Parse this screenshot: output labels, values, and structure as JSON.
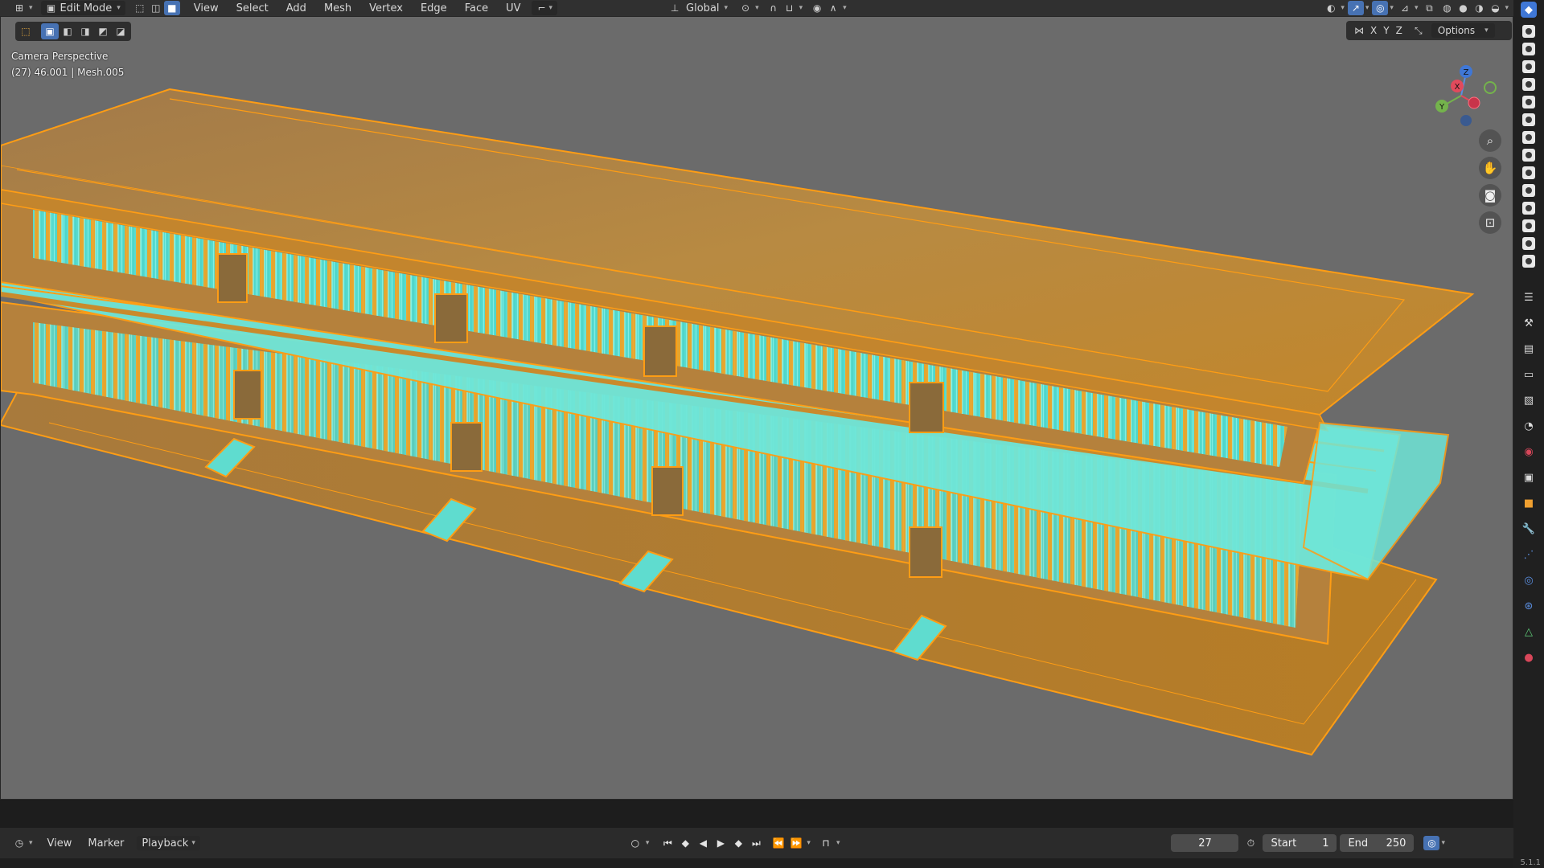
{
  "header": {
    "mode": "Edit Mode",
    "menus": [
      "View",
      "Select",
      "Add",
      "Mesh",
      "Vertex",
      "Edge",
      "Face",
      "UV"
    ],
    "transform_orientation": "Global"
  },
  "viewport": {
    "view_name": "Camera Perspective",
    "object_info": "(27) 46.001 | Mesh.005",
    "axis_x": "X",
    "axis_y": "Y",
    "axis_z": "Z",
    "options_label": "Options",
    "gizmo": {
      "z": "Z",
      "x": "X",
      "y": "Y"
    },
    "colors": {
      "background": "#6b6b6b",
      "face_selected": "#c98a2c",
      "edge_selected": "#ff9d14",
      "glass": "#7ff0e0"
    }
  },
  "timeline": {
    "menus": [
      "View",
      "Marker",
      "Playback"
    ],
    "current_frame": "27",
    "start_label": "Start",
    "start_value": "1",
    "end_label": "End",
    "end_value": "250"
  },
  "status": {
    "version": "5.1.1"
  },
  "icons": {
    "nav": [
      "zoom-icon",
      "hand-pan-icon",
      "camera-icon",
      "lock-icon"
    ],
    "properties": [
      "tool-icon",
      "render-icon",
      "output-icon",
      "view-layer-icon",
      "scene-icon",
      "world-icon",
      "collection-icon",
      "object-icon",
      "modifier-icon",
      "particles-icon",
      "physics-icon",
      "constraints-icon",
      "data-icon",
      "material-icon"
    ]
  }
}
